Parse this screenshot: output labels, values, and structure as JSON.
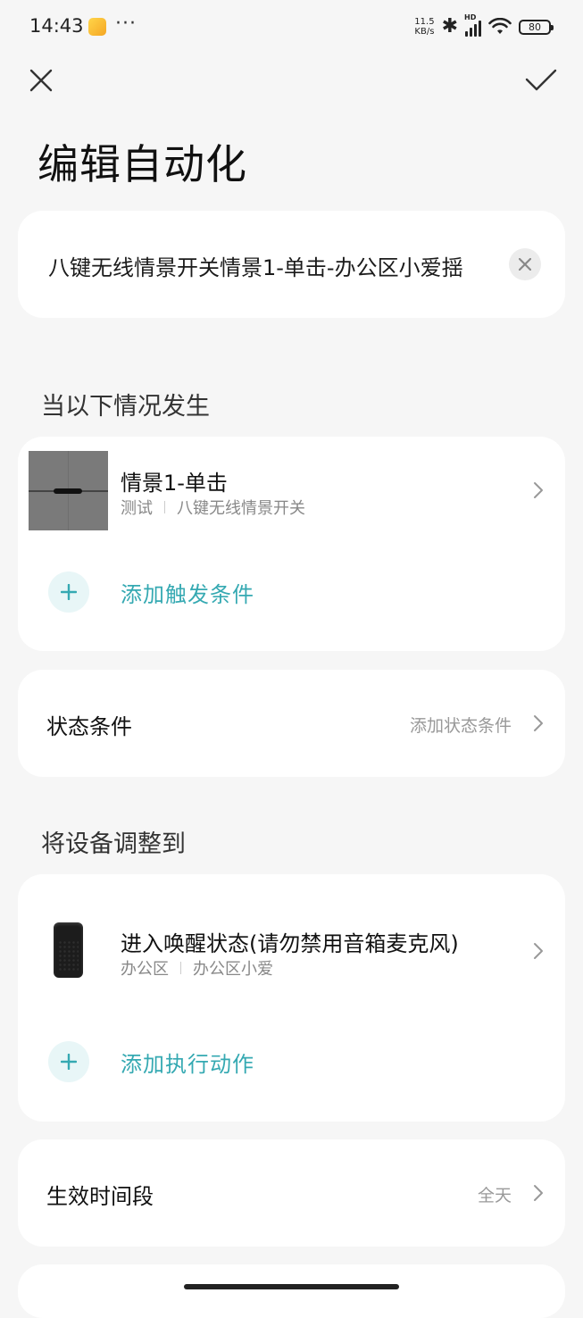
{
  "status_bar": {
    "time": "14:43",
    "more": "···",
    "net_speed_value": "11.5",
    "net_speed_unit": "KB/s",
    "bluetooth": "✱",
    "signal_label": "HD",
    "battery": "80"
  },
  "header": {
    "title": "编辑自动化"
  },
  "name_field": {
    "value": "八键无线情景开关情景1-单击-办公区小爱揺"
  },
  "trigger_section": {
    "label": "当以下情况发生",
    "items": [
      {
        "title": "情景1-单击",
        "room": "测试",
        "device": "八键无线情景开关"
      }
    ],
    "add_label": "添加触发条件"
  },
  "state_condition": {
    "label": "状态条件",
    "value": "添加状态条件"
  },
  "action_section": {
    "label": "将设备调整到",
    "items": [
      {
        "title": "进入唤醒状态(请勿禁用音箱麦克风)",
        "room": "办公区",
        "device": "办公区小爱"
      }
    ],
    "add_label": "添加执行动作"
  },
  "effective_time": {
    "label": "生效时间段",
    "value": "全天"
  },
  "colors": {
    "accent": "#35a9b2",
    "accent_bg": "#e8f6f7",
    "background": "#f6f6f6",
    "card": "#ffffff"
  },
  "icons": [
    "close-icon",
    "check-icon",
    "clear-icon",
    "plus-icon",
    "chevron-right-icon",
    "bluetooth-icon",
    "wifi-icon",
    "battery-icon"
  ]
}
